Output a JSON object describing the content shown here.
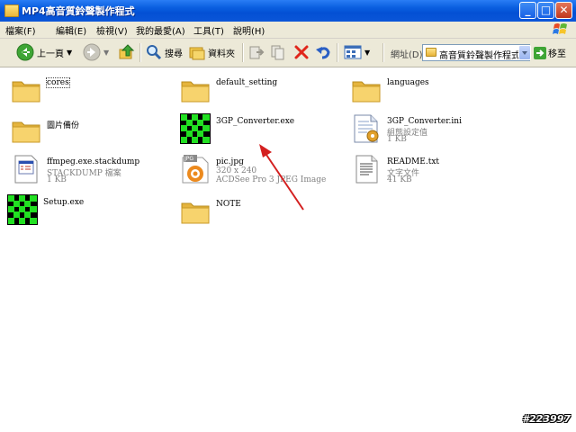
{
  "window": {
    "title": "MP4高音質鈴聲製作程式",
    "buttons": {
      "minimize": "_",
      "maximize": "□",
      "close": "✕"
    }
  },
  "menu": {
    "items": [
      "檔案(F)",
      "編輯(E)",
      "檢視(V)",
      "我的最愛(A)",
      "工具(T)",
      "說明(H)"
    ]
  },
  "toolbar": {
    "back_label": "上一頁",
    "search_label": "搜尋",
    "folders_label": "資料夾",
    "address_label": "網址(D)",
    "address_value": "高音質鈴聲製作程式",
    "go_label": "移至"
  },
  "files": [
    {
      "name": "cores",
      "kind": "folder"
    },
    {
      "name": "default_setting",
      "kind": "folder"
    },
    {
      "name": "languages",
      "kind": "folder"
    },
    {
      "name": "圖片備份",
      "kind": "folder"
    },
    {
      "name": "3GP_Converter.exe",
      "kind": "exe"
    },
    {
      "name": "3GP_Converter.ini",
      "kind": "ini",
      "sub1": "組態設定值",
      "sub2": "1 KB"
    },
    {
      "name": "ffmpeg.exe.stackdump",
      "kind": "dump",
      "sub1": "STACKDUMP 檔案",
      "sub2": "1 KB"
    },
    {
      "name": "pic.jpg",
      "kind": "jpg",
      "sub1": "320 x 240",
      "sub2": "ACDSee Pro 3 JPEG Image",
      "badge": "JPG"
    },
    {
      "name": "README.txt",
      "kind": "txt",
      "sub1": "文字文件",
      "sub2": "41 KB"
    },
    {
      "name": "Setup.exe",
      "kind": "exe"
    },
    {
      "name": "NOTE",
      "kind": "folder"
    }
  ],
  "watermark": "#223997",
  "colors": {
    "titlebar": "#0a5fe0",
    "arrow": "#d42020",
    "exe_icon": "#22e022"
  }
}
